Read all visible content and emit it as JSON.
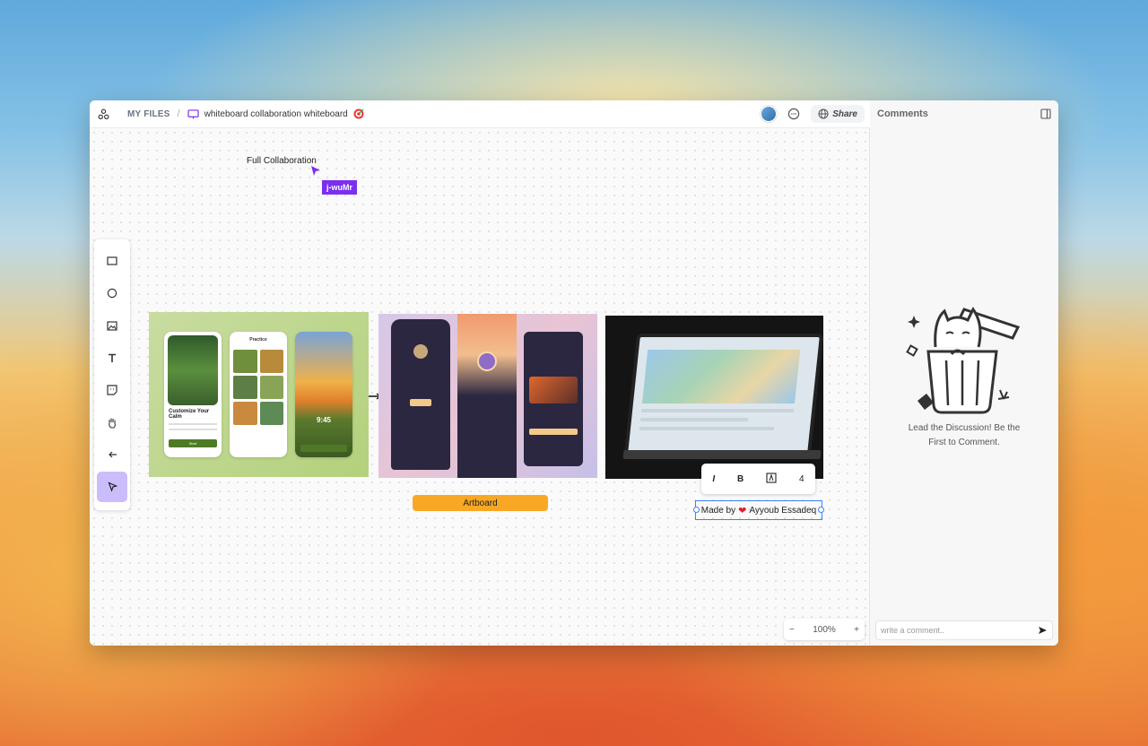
{
  "breadcrumb": {
    "root": "MY FILES",
    "separator": "/",
    "file_name": "whiteboard collaboration whiteboard"
  },
  "header": {
    "share_label": "Share"
  },
  "canvas": {
    "text_item": "Full Collaboration",
    "cursor_user": "j-wuMr",
    "artboard_label": "Artboard",
    "credit": {
      "prefix": "Made by",
      "author": "Ayyoub Essadeq"
    },
    "format_bar": {
      "italic": "I",
      "bold": "B",
      "font_size": "4"
    },
    "zoom": {
      "minus": "−",
      "level": "100%",
      "plus": "+"
    },
    "mock_phone1": {
      "title": "Customize Your Calm",
      "button": "Start"
    },
    "mock_phone2": {
      "title": "Practice"
    },
    "mock_phone3": {
      "time": "9:45"
    }
  },
  "tools": [
    "rectangle-tool",
    "ellipse-tool",
    "image-tool",
    "text-tool",
    "sticky-note-tool",
    "hand-tool",
    "arrow-tool",
    "select-tool"
  ],
  "comments": {
    "title": "Comments",
    "empty_message": "Lead the Discussion! Be the First to Comment.",
    "input_placeholder": "write a comment.."
  },
  "colors": {
    "accent": "#7b2ff0",
    "artboard": "#f9a825",
    "select_active": "#cbbdfb",
    "selection": "#3b82f6"
  }
}
